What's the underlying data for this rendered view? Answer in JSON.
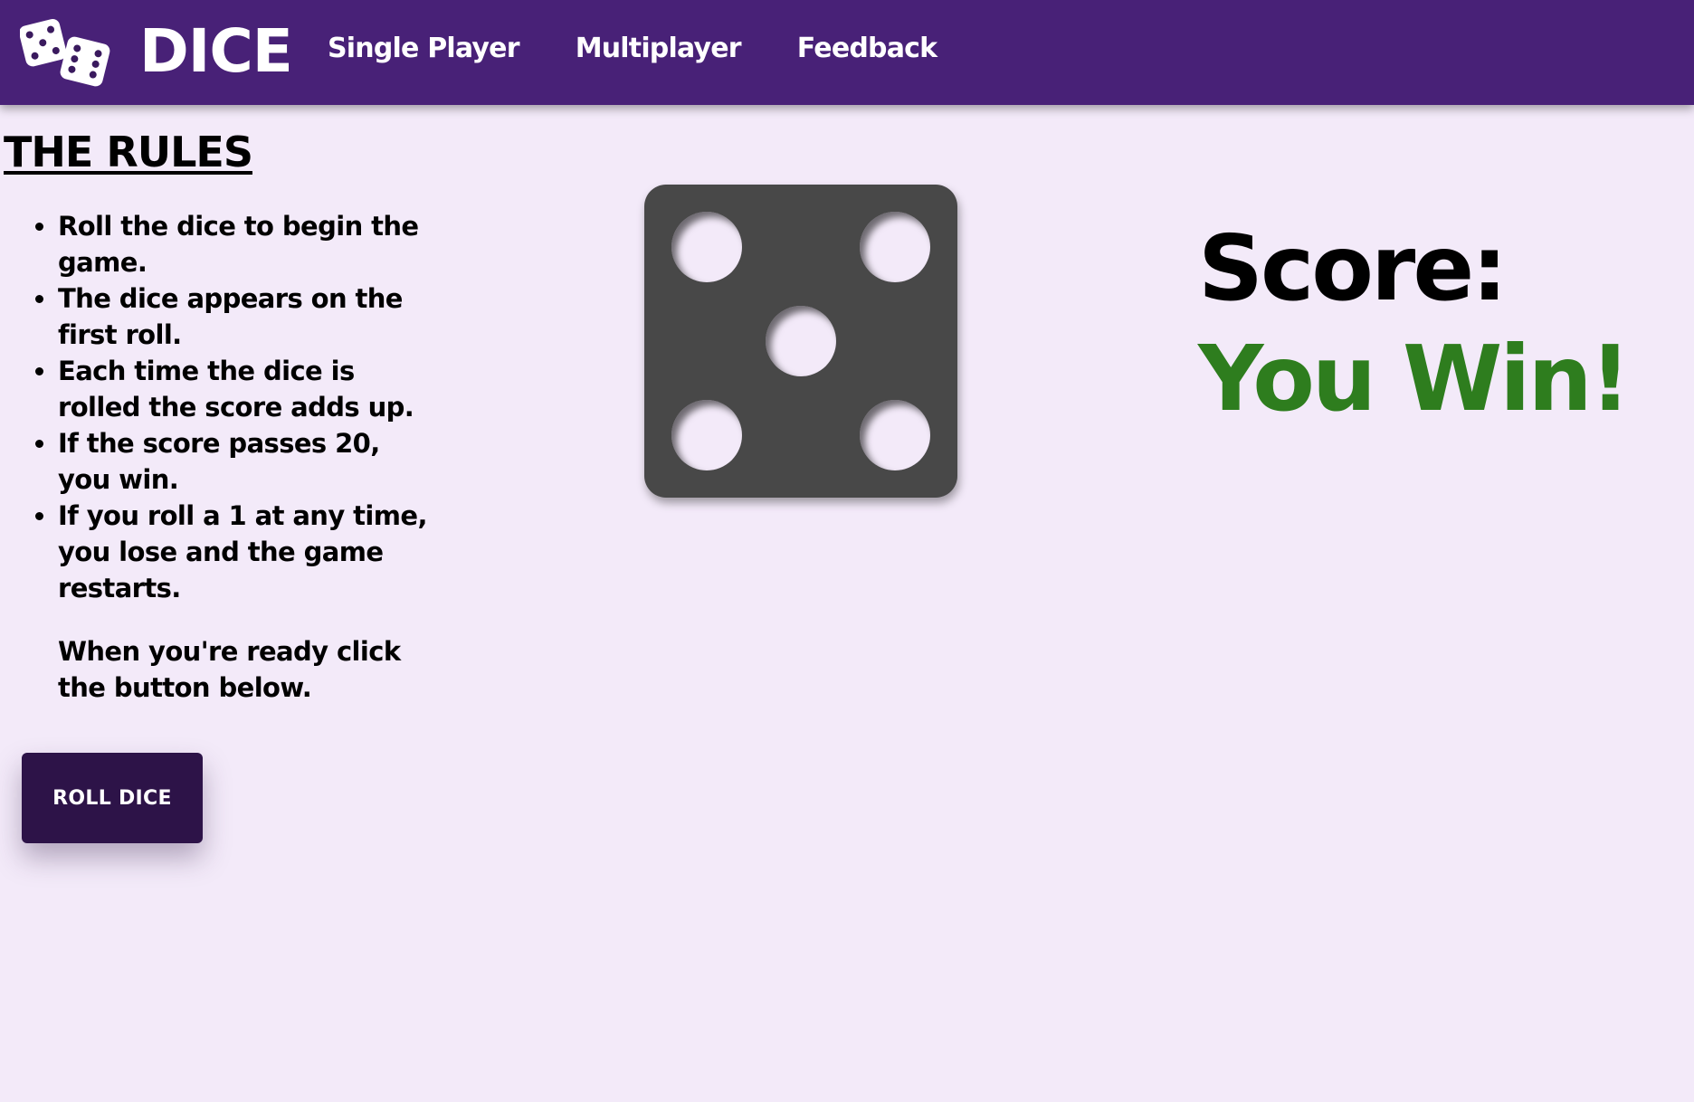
{
  "nav": {
    "brand": "DICE",
    "links": [
      "Single Player",
      "Multiplayer",
      "Feedback"
    ],
    "background_color": "#482177"
  },
  "rules": {
    "title": "THE RULES",
    "items": [
      "Roll the dice to begin the game.",
      "The dice appears on the first roll.",
      "Each time the dice is rolled the score adds up.",
      "If the score passes 20, you win.",
      "If you roll a 1 at any time, you lose and the game restarts."
    ],
    "ready_text": "When you're ready click the button below."
  },
  "roll_button": {
    "label": "ROLL DICE",
    "color": "#2d1348"
  },
  "die": {
    "value": 5,
    "color": "#484848"
  },
  "score": {
    "label": "Score:",
    "result": "You Win!",
    "result_color": "#2e7d1e"
  },
  "page": {
    "background_color": "#f3eaf9"
  }
}
